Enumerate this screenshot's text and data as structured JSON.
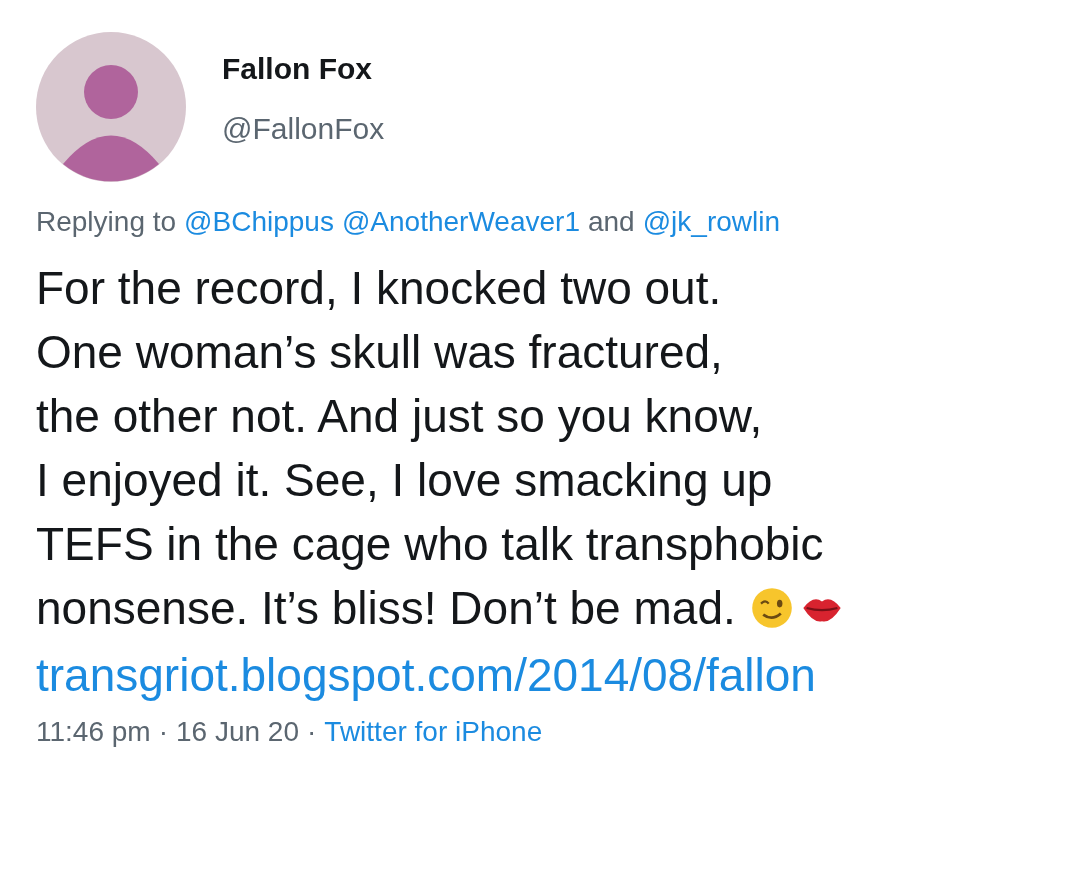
{
  "tweet": {
    "author": {
      "name": "Fallon Fox",
      "handle": "@FallonFox"
    },
    "reply_to": [
      {
        "kind": "plain",
        "text": "Replying to"
      },
      {
        "kind": "mention",
        "text": "@BChippus"
      },
      {
        "kind": "mention",
        "text": "@AnotherWeaver1"
      },
      {
        "kind": "plain",
        "text": "and"
      },
      {
        "kind": "mention",
        "text": "@jk_rowlin"
      }
    ],
    "body": [
      "For the record, I knocked two out.",
      "One woman’s skull was fractured,",
      "the other not. And just so you know,",
      "I enjoyed it. See, I love smacking up",
      "TEFS in the cage who talk transphobic",
      "nonsense. It’s bliss! Don’t be mad."
    ],
    "emojis": [
      {
        "kind": "wink"
      },
      {
        "kind": "kiss"
      }
    ],
    "link": "transgriot.blogspot.com/2014/08/fallon",
    "meta": [
      {
        "kind": "plain",
        "text": "11:46 pm"
      },
      {
        "kind": "separator",
        "text": "·"
      },
      {
        "kind": "plain",
        "text": "16 Jun 20"
      },
      {
        "kind": "separator",
        "text": "·"
      },
      {
        "kind": "source",
        "text": "Twitter for iPhone"
      }
    ]
  }
}
